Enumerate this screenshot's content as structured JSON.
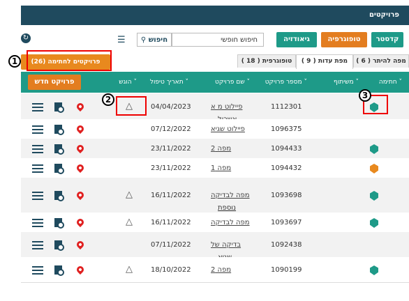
{
  "header": {
    "title": "פרויקטים"
  },
  "toolbar": {
    "cadastre": "קדסטר",
    "topography": "טופוגרפיה",
    "geodesy": "גיאודזיה",
    "search_placeholder": "חיפוש חופשי",
    "search_button": "חיפוש"
  },
  "tabs": [
    {
      "label": "מפה להיתר ( 6 )"
    },
    {
      "label": "מפת עדות ( 9 )"
    },
    {
      "label": "טופוגרפית ( 18 )"
    }
  ],
  "signing_button": "פרויקטים לחתימה (26)",
  "new_project": "פרויקט חדש",
  "columns": [
    "חתימה",
    "משיתוף",
    "מספר פרויקט",
    "שם פרויקט",
    "תאריך טיפול",
    "הוגש"
  ],
  "rows": [
    {
      "date": "04/04/2023",
      "name": "פיילוט מ א",
      "name2": "אשכול",
      "num": "1112301",
      "shield": "teal",
      "surv": true
    },
    {
      "date": "07/12/2022",
      "name": "פיילוט שגיא",
      "name2": "",
      "num": "1096375",
      "shield": "",
      "surv": false
    },
    {
      "date": "23/11/2022",
      "name": "מפה 2",
      "name2": "",
      "num": "1094433",
      "shield": "teal",
      "surv": false
    },
    {
      "date": "23/11/2022",
      "name": "מפה 1",
      "name2": "",
      "num": "1094432",
      "shield": "orange",
      "surv": false
    },
    {
      "date": "16/11/2022",
      "name": "מפה לבדיקה",
      "name2": "נוספת",
      "num": "1093698",
      "shield": "teal",
      "surv": true
    },
    {
      "date": "16/11/2022",
      "name": "מפה לבדיקה",
      "name2": "",
      "num": "1093697",
      "shield": "teal",
      "surv": true
    },
    {
      "date": "07/11/2022",
      "name": "בדיקה של",
      "name2": "שגיא",
      "num": "1092438",
      "shield": "",
      "surv": false
    },
    {
      "date": "18/10/2022",
      "name": "מפה 2",
      "name2": "",
      "num": "1090199",
      "shield": "teal",
      "surv": true
    }
  ],
  "annotations": [
    "1",
    "2",
    "3"
  ],
  "colors": {
    "header": "#1f4a5e",
    "teal": "#1e9a88",
    "orange": "#e8891e"
  }
}
